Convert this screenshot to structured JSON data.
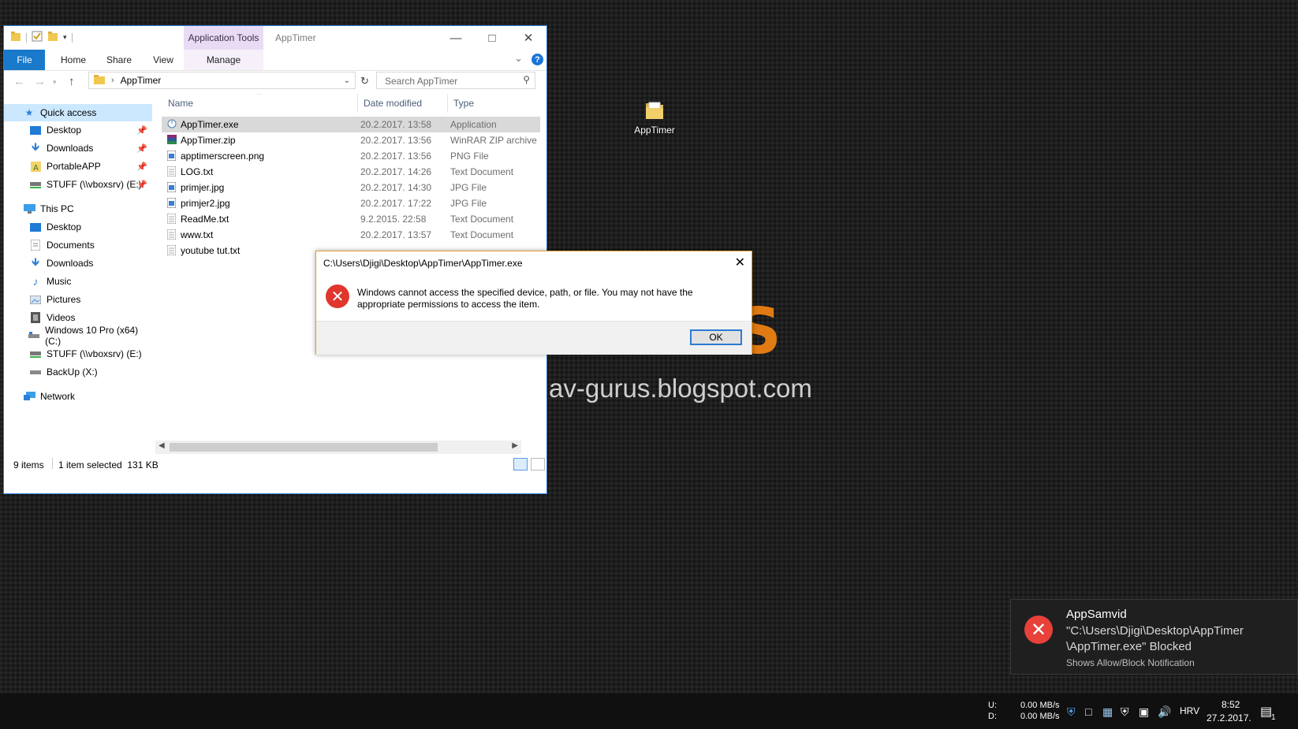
{
  "desktop": {
    "wallpaper_logo": "GURUS",
    "wallpaper_url": "av-gurus.blogspot.com",
    "icon_label": "AppTimer"
  },
  "explorer": {
    "context_tab": "Application Tools",
    "window_title": "AppTimer",
    "ribbon_tabs": [
      "File",
      "Home",
      "Share",
      "View",
      "Manage"
    ],
    "help": "?",
    "address": "AppTimer",
    "search_placeholder": "Search AppTimer",
    "nav": {
      "quick_access": "Quick access",
      "quick_items": [
        "Desktop",
        "Downloads",
        "PortableAPP",
        "STUFF (\\\\vboxsrv) (E:)"
      ],
      "this_pc": "This PC",
      "pc_items": [
        "Desktop",
        "Documents",
        "Downloads",
        "Music",
        "Pictures",
        "Videos",
        "Windows 10 Pro (x64) (C:)",
        "STUFF (\\\\vboxsrv) (E:)",
        "BackUp (X:)"
      ],
      "network": "Network"
    },
    "columns": {
      "name": "Name",
      "date": "Date modified",
      "type": "Type"
    },
    "files": [
      {
        "name": "AppTimer.exe",
        "date": "20.2.2017. 13:58",
        "type": "Application",
        "icon": "app-icon"
      },
      {
        "name": "AppTimer.zip",
        "date": "20.2.2017. 13:56",
        "type": "WinRAR ZIP archive",
        "icon": "winrar-icon"
      },
      {
        "name": "apptimerscreen.png",
        "date": "20.2.2017. 13:56",
        "type": "PNG File",
        "icon": "image-icon"
      },
      {
        "name": "LOG.txt",
        "date": "20.2.2017. 14:26",
        "type": "Text Document",
        "icon": "text-file-icon"
      },
      {
        "name": "primjer.jpg",
        "date": "20.2.2017. 14:30",
        "type": "JPG File",
        "icon": "image-icon"
      },
      {
        "name": "primjer2.jpg",
        "date": "20.2.2017. 17:22",
        "type": "JPG File",
        "icon": "image-icon"
      },
      {
        "name": "ReadMe.txt",
        "date": "9.2.2015. 22:58",
        "type": "Text Document",
        "icon": "text-file-icon"
      },
      {
        "name": "www.txt",
        "date": "20.2.2017. 13:57",
        "type": "Text Document",
        "icon": "text-file-icon"
      },
      {
        "name": "youtube tut.txt",
        "date": "",
        "type": "",
        "icon": "text-file-icon"
      }
    ],
    "status_count": "9 items",
    "status_selected": "1 item selected  131 KB"
  },
  "dialog": {
    "title": "C:\\Users\\Djigi\\Desktop\\AppTimer\\AppTimer.exe",
    "message": "Windows cannot access the specified device, path, or file. You may not have the appropriate permissions to access the item.",
    "ok": "OK"
  },
  "toast": {
    "app": "AppSamvid",
    "body": "\"C:\\Users\\Djigi\\Desktop\\AppTimer \\AppTimer.exe\" Blocked",
    "attribution": "Shows Allow/Block Notification"
  },
  "taskbar": {
    "net_up_label": "U:",
    "net_down_label": "D:",
    "net_up": "0.00 MB/s",
    "net_down": "0.00 MB/s",
    "language": "HRV",
    "time": "8:52",
    "date": "27.2.2017.",
    "notif_count": "1"
  },
  "colors": {
    "accent": "#1979ca",
    "error": "#e0362c",
    "wallpaper_orange": "#e07a12"
  }
}
